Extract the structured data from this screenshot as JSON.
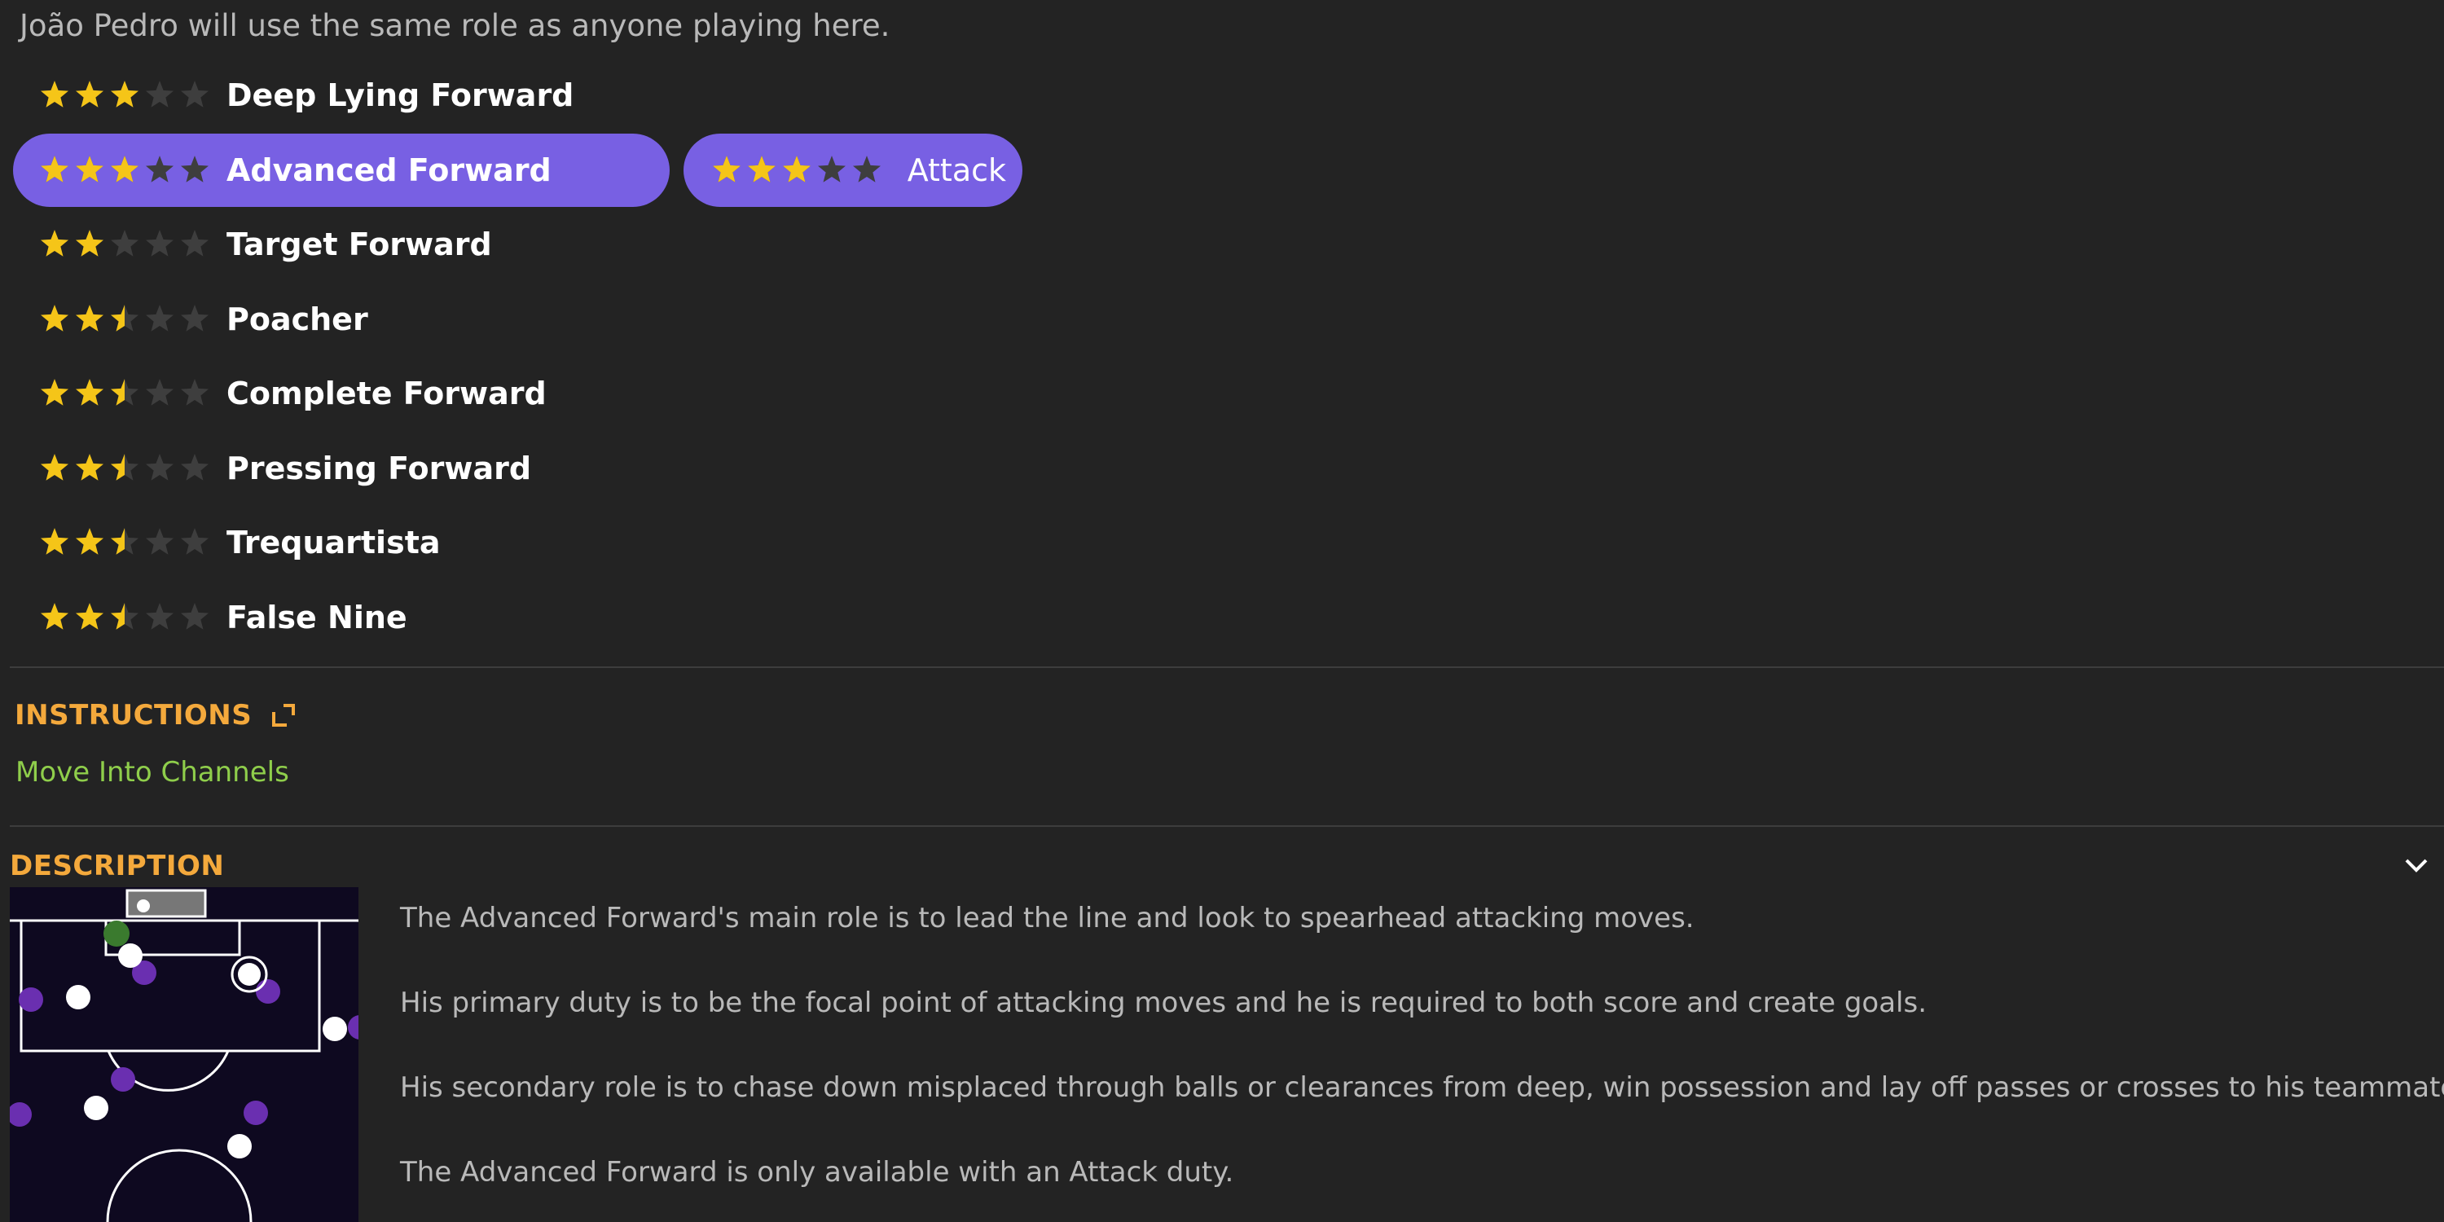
{
  "header_note": "João Pedro will use the same role as anyone playing here.",
  "roles": [
    {
      "name": "Deep Lying Forward",
      "rating": 3,
      "selected": false
    },
    {
      "name": "Advanced Forward",
      "rating": 3,
      "selected": true
    },
    {
      "name": "Target Forward",
      "rating": 2,
      "selected": false
    },
    {
      "name": "Poacher",
      "rating": 2.5,
      "selected": false
    },
    {
      "name": "Complete Forward",
      "rating": 2.5,
      "selected": false
    },
    {
      "name": "Pressing Forward",
      "rating": 2.5,
      "selected": false
    },
    {
      "name": "Trequartista",
      "rating": 2.5,
      "selected": false
    },
    {
      "name": "False Nine",
      "rating": 2.5,
      "selected": false
    }
  ],
  "duty": {
    "label": "Attack",
    "rating": 3
  },
  "instructions": {
    "title": "INSTRUCTIONS",
    "items": [
      "Move Into Channels"
    ]
  },
  "description": {
    "title": "DESCRIPTION",
    "paragraphs": [
      "The Advanced Forward's main role is to lead the line and look to spearhead attacking moves.",
      "His primary duty is to be the focal point of attacking moves and he is required to both score and create goals.",
      "His secondary role is to chase down misplaced through balls or clearances from deep, win possession and lay off passes or crosses to his teammates.",
      "The Advanced Forward is only available with an Attack duty."
    ]
  },
  "colors": {
    "accent_purple": "#7860e3",
    "star_filled": "#f5c518",
    "star_empty": "#3e3e3e",
    "section_title": "#f4a93c",
    "instruction_text": "#8fce4b",
    "player_own": "#ffffff",
    "player_opponent": "#6a2fb0",
    "goalkeeper": "#3a7a2e"
  },
  "icons": {
    "expand": "expand-arrow-icon",
    "collapse": "chevron-down-icon",
    "star": "star-icon"
  }
}
